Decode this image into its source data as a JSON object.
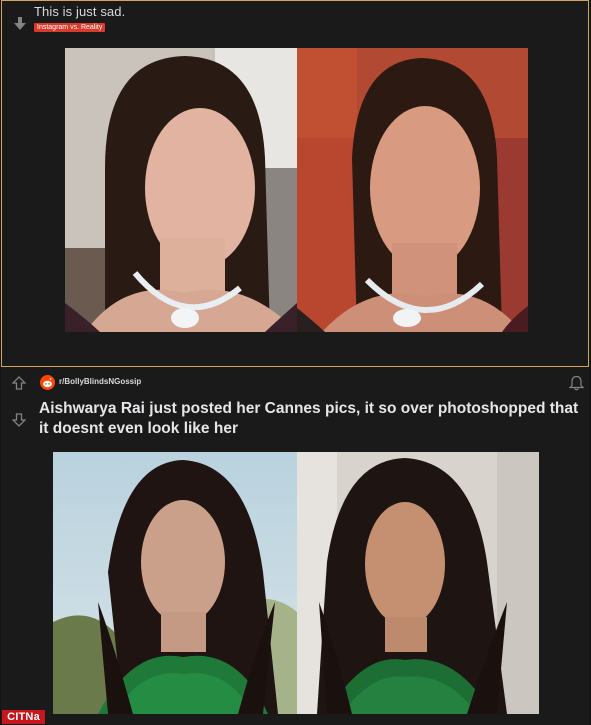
{
  "top_post": {
    "title": "This is just sad.",
    "flair": "Instagram vs. Reality",
    "vote_down_icon": "downvote-arrow-icon"
  },
  "bottom_post": {
    "subreddit": "r/BollyBlindsNGossip",
    "title": "Aishwarya Rai just posted her Cannes pics, it so over photoshopped that it doesnt even look like her",
    "icons": [
      "upvote-arrow-icon",
      "downvote-arrow-icon",
      "notification-bell-icon",
      "subreddit-avatar-icon"
    ]
  },
  "watermark": {
    "text": "CITNa"
  },
  "colors": {
    "background": "#141416",
    "card": "#1a1a1b",
    "card_border": "#d6a35a",
    "flair": "#d93a2b",
    "watermark": "#c8161d",
    "text": "#d7dadc",
    "reddit_orange": "#ff4500"
  }
}
